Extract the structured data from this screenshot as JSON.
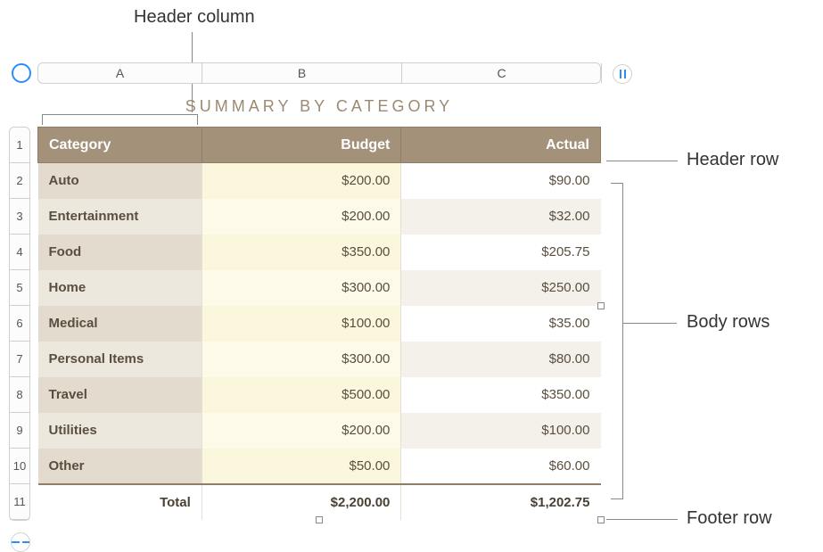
{
  "callouts": {
    "header_column": "Header column",
    "header_row": "Header row",
    "body_rows": "Body rows",
    "footer_row": "Footer row"
  },
  "columns": {
    "labels": [
      "A",
      "B",
      "C"
    ]
  },
  "rows": {
    "labels": [
      "1",
      "2",
      "3",
      "4",
      "5",
      "6",
      "7",
      "8",
      "9",
      "10",
      "11"
    ]
  },
  "table": {
    "title": "SUMMARY BY CATEGORY",
    "headers": {
      "category": "Category",
      "budget": "Budget",
      "actual": "Actual"
    },
    "body": [
      {
        "category": "Auto",
        "budget": "$200.00",
        "actual": "$90.00"
      },
      {
        "category": "Entertainment",
        "budget": "$200.00",
        "actual": "$32.00"
      },
      {
        "category": "Food",
        "budget": "$350.00",
        "actual": "$205.75"
      },
      {
        "category": "Home",
        "budget": "$300.00",
        "actual": "$250.00"
      },
      {
        "category": "Medical",
        "budget": "$100.00",
        "actual": "$35.00"
      },
      {
        "category": "Personal Items",
        "budget": "$300.00",
        "actual": "$80.00"
      },
      {
        "category": "Travel",
        "budget": "$500.00",
        "actual": "$350.00"
      },
      {
        "category": "Utilities",
        "budget": "$200.00",
        "actual": "$100.00"
      },
      {
        "category": "Other",
        "budget": "$50.00",
        "actual": "$60.00"
      }
    ],
    "footer": {
      "label": "Total",
      "budget": "$2,200.00",
      "actual": "$1,202.75"
    }
  }
}
